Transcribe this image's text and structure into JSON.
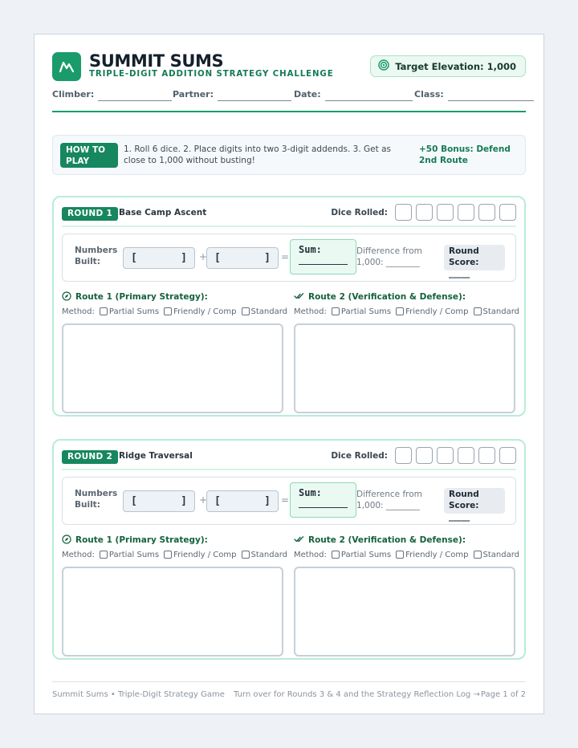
{
  "header": {
    "title": "SUMMIT SUMS",
    "subtitle": "TRIPLE-DIGIT ADDITION STRATEGY CHALLENGE",
    "target": "Target Elevation: 1,000",
    "fields": {
      "climber": "Climber:",
      "partner": "Partner:",
      "date": "Date:",
      "class": "Class:"
    }
  },
  "howto": {
    "badge_line1": "HOW TO",
    "badge_line2": "PLAY",
    "text": "1. Roll 6 dice. 2. Place digits into two 3-digit addends. 3. Get as close to 1,000 without busting!",
    "bonus": "+50 Bonus: Defend 2nd Route"
  },
  "rounds": [
    {
      "badge": "ROUND 1",
      "name": "Base Camp Ascent",
      "dice_label": "Dice Rolled:",
      "numbers_label_1": "Numbers",
      "numbers_label_2": "Built:",
      "bracket_open": "[",
      "bracket_close": "]",
      "plus": "+",
      "equals": "=",
      "sum_label": "Sum:",
      "diff_line1": "Difference from",
      "diff_line2": "1,000: ________",
      "score_line1": "Round",
      "score_line2": "Score: _____",
      "route1_title": "Route 1 (Primary Strategy):",
      "route2_title": "Route 2 (Verification & Defense):",
      "method_label": "Method:",
      "opt1": "Partial Sums",
      "opt2": "Friendly / Comp",
      "opt3": "Standard"
    },
    {
      "badge": "ROUND 2",
      "name": "Ridge Traversal",
      "dice_label": "Dice Rolled:",
      "numbers_label_1": "Numbers",
      "numbers_label_2": "Built:",
      "bracket_open": "[",
      "bracket_close": "]",
      "plus": "+",
      "equals": "=",
      "sum_label": "Sum:",
      "diff_line1": "Difference from",
      "diff_line2": "1,000: ________",
      "score_line1": "Round",
      "score_line2": "Score: _____",
      "route1_title": "Route 1 (Primary Strategy):",
      "route2_title": "Route 2 (Verification & Defense):",
      "method_label": "Method:",
      "opt1": "Partial Sums",
      "opt2": "Friendly / Comp",
      "opt3": "Standard"
    }
  ],
  "footer": {
    "left": "Summit Sums • Triple-Digit Strategy Game",
    "center": "Turn over for Rounds 3 & 4 and the Strategy Reflection Log →",
    "right": "Page 1 of 2"
  },
  "colors": {
    "accent": "#1a9b6c",
    "accent_dark": "#16875f",
    "round_border": "#b8ecd6"
  },
  "icons": {
    "logo": "mountain-icon",
    "target": "target-icon",
    "route1": "compass-icon",
    "route2": "double-check-icon"
  }
}
